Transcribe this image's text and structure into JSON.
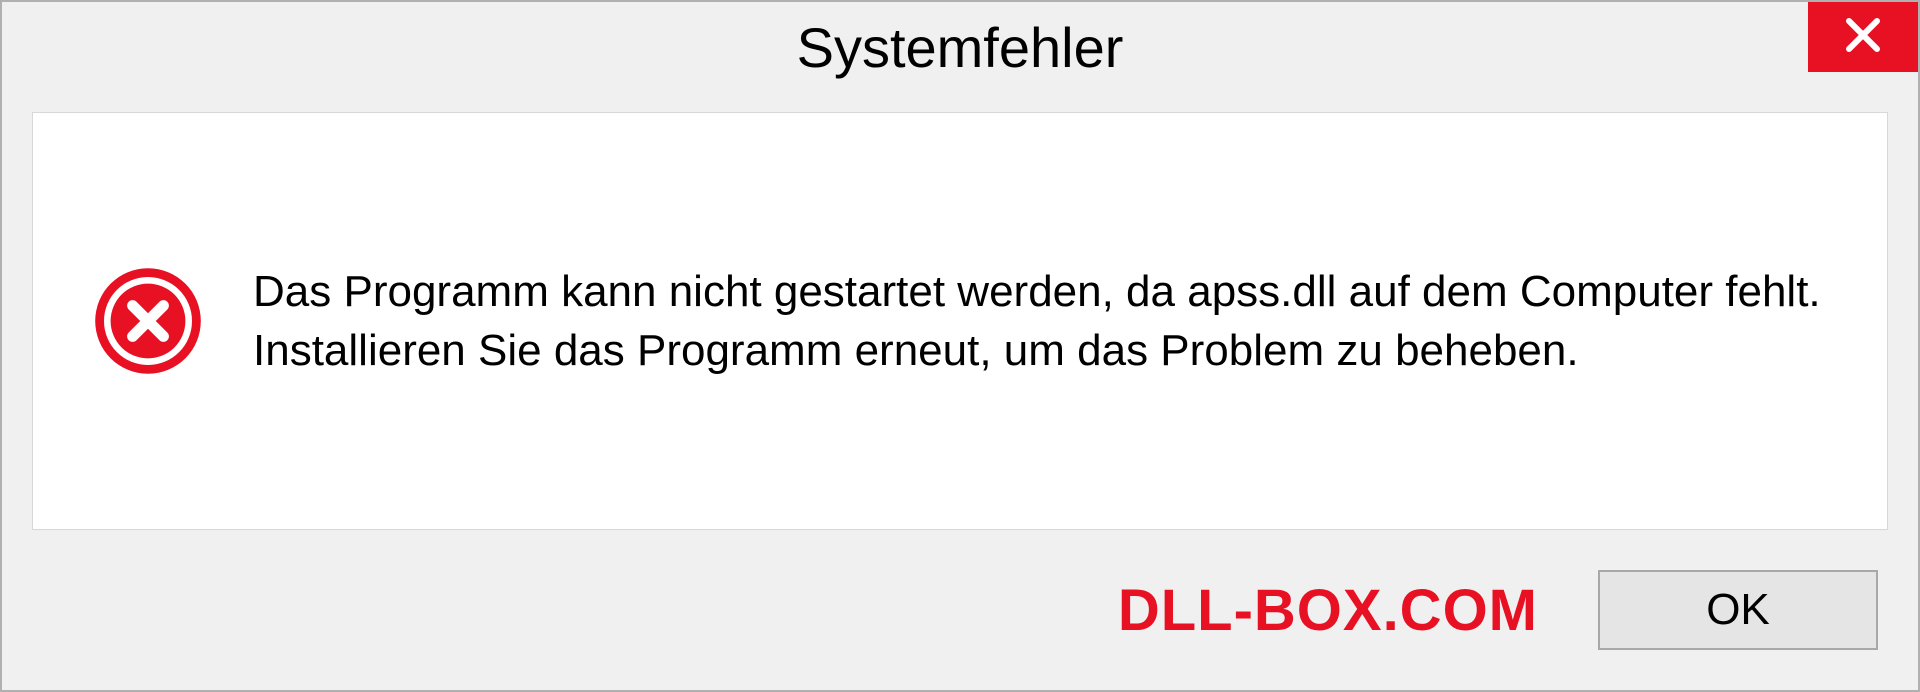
{
  "dialog": {
    "title": "Systemfehler",
    "message": "Das Programm kann nicht gestartet werden, da apss.dll auf dem Computer fehlt. Installieren Sie das Programm erneut, um das Problem zu beheben.",
    "ok_label": "OK"
  },
  "watermark": "DLL-BOX.COM"
}
